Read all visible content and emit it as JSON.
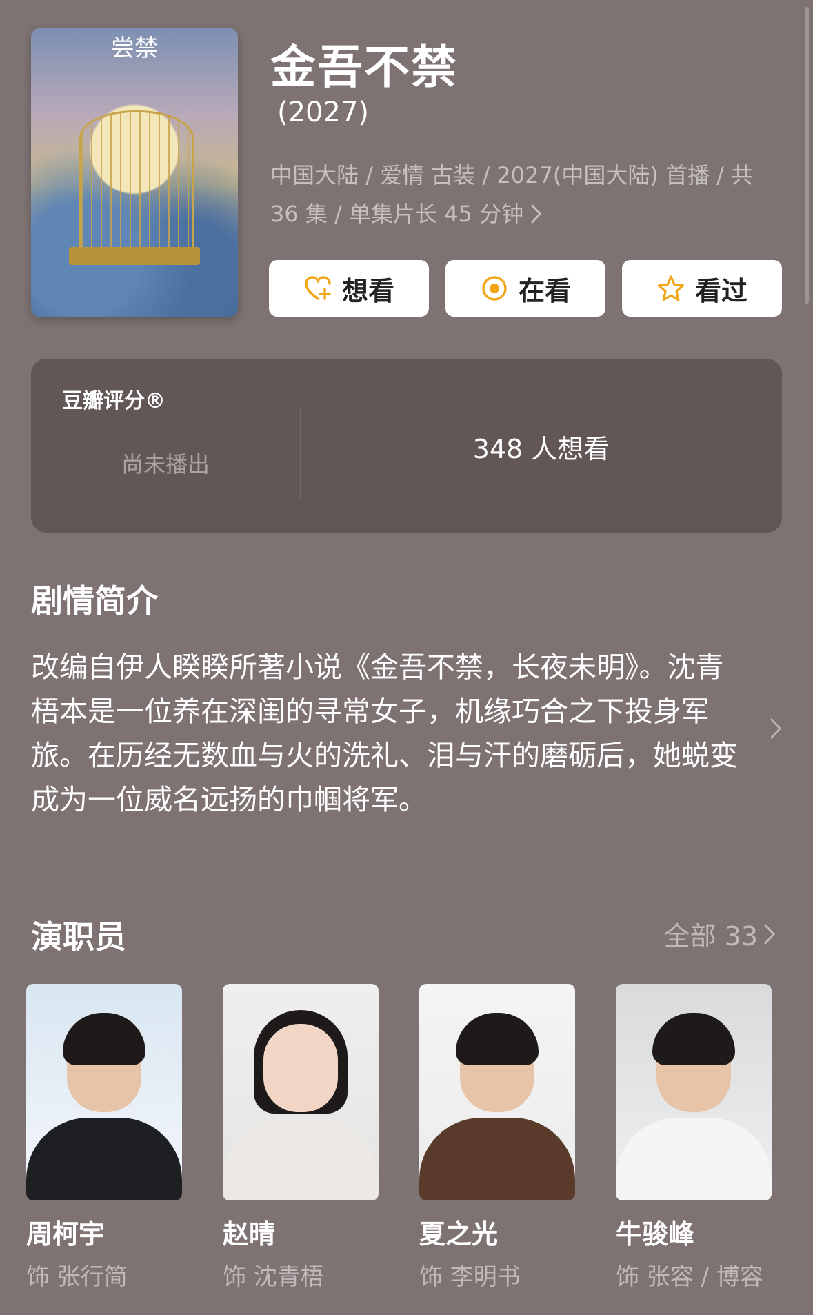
{
  "header": {
    "title": "金吾不禁",
    "year": "(2027)",
    "poster_logo": "尝禁",
    "meta_line1": "中国大陆 / 爱情 古装 / 2027(中国大陆) 首播 / 共",
    "meta_line2": "36 集 / 单集片长 45 分钟"
  },
  "actions": [
    {
      "label": "想看",
      "icon": "heart-plus-icon",
      "color": "#f2a516"
    },
    {
      "label": "在看",
      "icon": "target-icon",
      "color": "#f2a516"
    },
    {
      "label": "看过",
      "icon": "star-icon",
      "color": "#f2a516"
    }
  ],
  "rating": {
    "title": "豆瓣评分®",
    "status": "尚未播出",
    "wish_count": "348 人想看"
  },
  "synopsis": {
    "title": "剧情简介",
    "text": "改编自伊人睽睽所著小说《金吾不禁，长夜未明》。沈青梧本是一位养在深闺的寻常女子，机缘巧合之下投身军旅。在历经无数血与火的洗礼、泪与汗的磨砺后，她蜕变成为一位威名远扬的巾帼将军。"
  },
  "cast": {
    "title": "演职员",
    "all_label": "全部 33",
    "members": [
      {
        "name": "周柯宇",
        "role": "饰 张行简"
      },
      {
        "name": "赵晴",
        "role": "饰 沈青梧"
      },
      {
        "name": "夏之光",
        "role": "饰 李明书"
      },
      {
        "name": "牛骏峰",
        "role": "饰 张容 / 博容"
      }
    ]
  }
}
